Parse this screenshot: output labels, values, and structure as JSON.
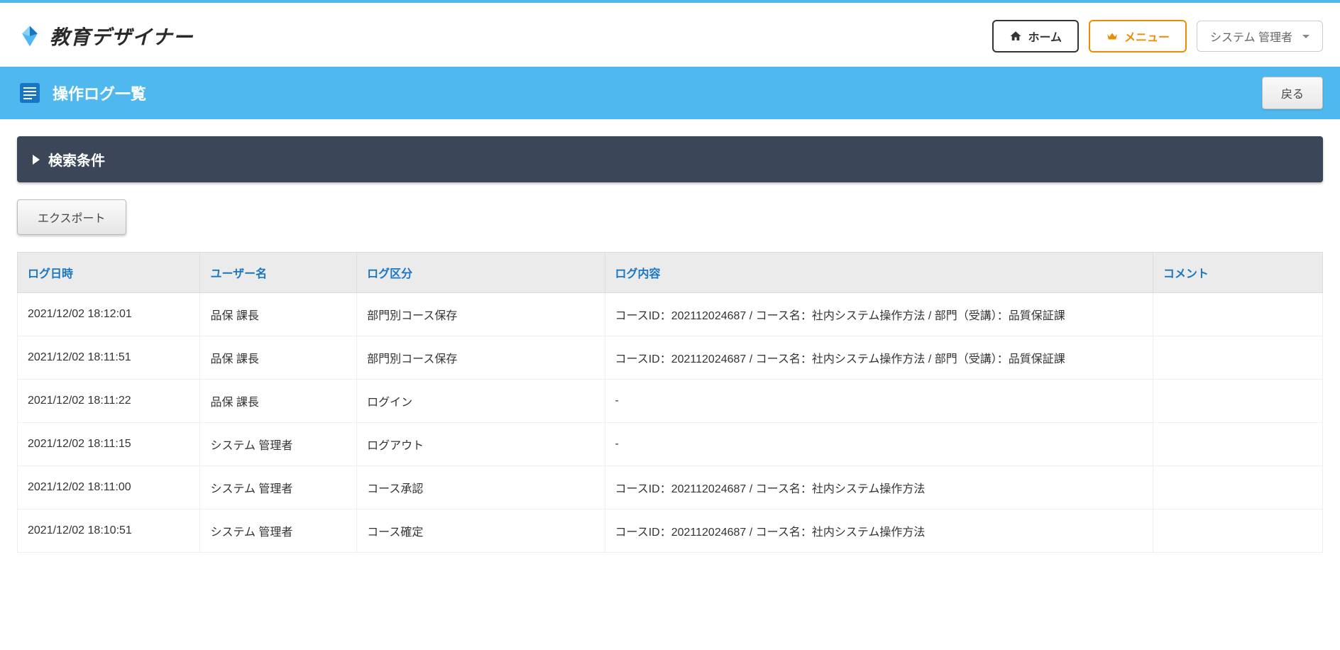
{
  "header": {
    "logo_text": "教育デザイナー",
    "home_label": "ホーム",
    "menu_label": "メニュー",
    "user_label": "システム 管理者"
  },
  "title_bar": {
    "title": "操作ログ一覧",
    "back_label": "戻る"
  },
  "search": {
    "label": "検索条件"
  },
  "actions": {
    "export_label": "エクスポート"
  },
  "table": {
    "headers": {
      "datetime": "ログ日時",
      "user": "ユーザー名",
      "type": "ログ区分",
      "content": "ログ内容",
      "comment": "コメント"
    },
    "rows": [
      {
        "datetime": "2021/12/02 18:12:01",
        "user": "品保 課長",
        "type": "部門別コース保存",
        "content": "コースID：202112024687 / コース名：社内システム操作方法 / 部門（受講）：品質保証課",
        "comment": ""
      },
      {
        "datetime": "2021/12/02 18:11:51",
        "user": "品保 課長",
        "type": "部門別コース保存",
        "content": "コースID：202112024687 / コース名：社内システム操作方法 / 部門（受講）：品質保証課",
        "comment": ""
      },
      {
        "datetime": "2021/12/02 18:11:22",
        "user": "品保 課長",
        "type": "ログイン",
        "content": "-",
        "comment": ""
      },
      {
        "datetime": "2021/12/02 18:11:15",
        "user": "システム 管理者",
        "type": "ログアウト",
        "content": "-",
        "comment": ""
      },
      {
        "datetime": "2021/12/02 18:11:00",
        "user": "システム 管理者",
        "type": "コース承認",
        "content": "コースID：202112024687 / コース名：社内システム操作方法",
        "comment": ""
      },
      {
        "datetime": "2021/12/02 18:10:51",
        "user": "システム 管理者",
        "type": "コース確定",
        "content": "コースID：202112024687 / コース名：社内システム操作方法",
        "comment": ""
      }
    ]
  }
}
